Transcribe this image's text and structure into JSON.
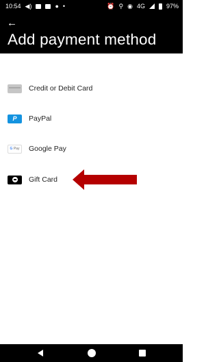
{
  "status_bar": {
    "time": "10:54",
    "network": "4G",
    "battery": "97%"
  },
  "header": {
    "back_icon": "back-arrow-icon",
    "title": "Add payment method",
    "background": "#000000"
  },
  "payment_methods": [
    {
      "label": "Credit or Debit Card",
      "icon": "credit-card-icon"
    },
    {
      "label": "PayPal",
      "icon": "paypal-icon",
      "icon_text": "P",
      "color": "#1493e0"
    },
    {
      "label": "Google Pay",
      "icon": "google-pay-icon",
      "icon_text_g": "G",
      "icon_text_pay": "Pay"
    },
    {
      "label": "Gift Card",
      "icon": "gift-card-icon"
    }
  ],
  "annotation": {
    "icon": "red-arrow-icon",
    "color": "#b50000"
  },
  "nav_bar": {
    "back": "nav-back-icon",
    "home": "nav-home-icon",
    "recents": "nav-recents-icon"
  }
}
